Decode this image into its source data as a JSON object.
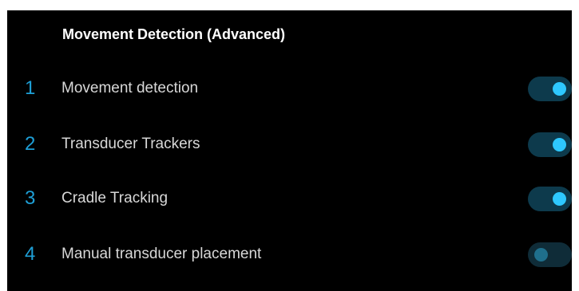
{
  "panel": {
    "title": "Movement Detection (Advanced)"
  },
  "settings": [
    {
      "number": "1",
      "label": "Movement detection",
      "enabled": true
    },
    {
      "number": "2",
      "label": "Transducer Trackers",
      "enabled": true
    },
    {
      "number": "3",
      "label": "Cradle Tracking",
      "enabled": true
    },
    {
      "number": "4",
      "label": "Manual transducer placement",
      "enabled": false
    }
  ],
  "colors": {
    "background": "#000000",
    "accent": "#2ec8ff",
    "number": "#1e9fd6",
    "toggle_track": "#0d3a4c"
  }
}
